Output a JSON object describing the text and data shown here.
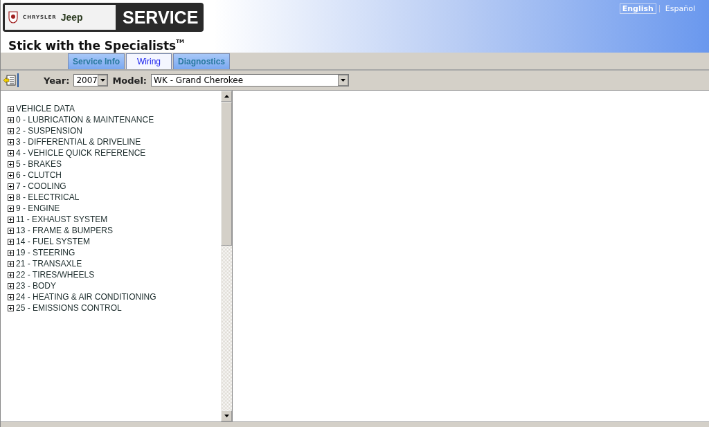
{
  "header": {
    "logo": {
      "brand_2": "CHRYSLER",
      "brand_3": "Jeep",
      "title": "SERVICE"
    },
    "tagline": "Stick with the Specialists",
    "tagline_mark": "TM",
    "languages": [
      {
        "label": "English",
        "selected": true
      },
      {
        "label": "Español",
        "selected": false
      }
    ]
  },
  "tabs": [
    {
      "label": "Service Info",
      "selected": false
    },
    {
      "label": "Wiring",
      "selected": true
    },
    {
      "label": "Diagnostics",
      "selected": false
    }
  ],
  "toolbar": {
    "year_label": "Year:",
    "year": "2007",
    "model_label": "Model:",
    "model": "WK - Grand Cherokee"
  },
  "tree": [
    {
      "label": "VEHICLE DATA",
      "expanded": false
    },
    {
      "label": "0 - LUBRICATION & MAINTENANCE",
      "expanded": false
    },
    {
      "label": "2 - SUSPENSION",
      "expanded": false
    },
    {
      "label": "3 - DIFFERENTIAL & DRIVELINE",
      "expanded": false
    },
    {
      "label": "4 - VEHICLE QUICK REFERENCE",
      "expanded": false
    },
    {
      "label": "5 - BRAKES",
      "expanded": false
    },
    {
      "label": "6 - CLUTCH",
      "expanded": false
    },
    {
      "label": "7 - COOLING",
      "expanded": false
    },
    {
      "label": "8 - ELECTRICAL",
      "expanded": false
    },
    {
      "label": "9 - ENGINE",
      "expanded": false
    },
    {
      "label": "11 - EXHAUST SYSTEM",
      "expanded": false
    },
    {
      "label": "13 - FRAME & BUMPERS",
      "expanded": false
    },
    {
      "label": "14 - FUEL SYSTEM",
      "expanded": false
    },
    {
      "label": "19 - STEERING",
      "expanded": false
    },
    {
      "label": "21 - TRANSAXLE",
      "expanded": false
    },
    {
      "label": "22 - TIRES/WHEELS",
      "expanded": false
    },
    {
      "label": "23 - BODY",
      "expanded": false
    },
    {
      "label": "24 - HEATING & AIR CONDITIONING",
      "expanded": false
    },
    {
      "label": "25 - EMISSIONS CONTROL",
      "expanded": false
    }
  ]
}
